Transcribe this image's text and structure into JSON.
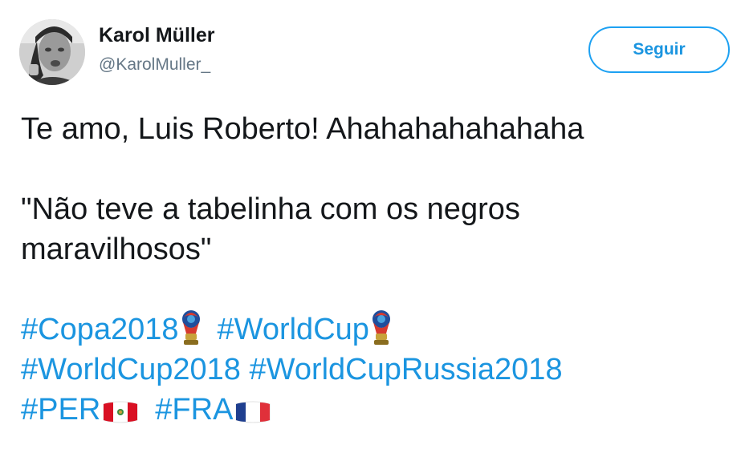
{
  "user": {
    "display_name": "Karol Müller",
    "handle": "@KarolMuller_"
  },
  "follow_button": {
    "label": "Seguir"
  },
  "tweet": {
    "line1": "Te amo, Luis Roberto! Ahahahahahahaha",
    "quote_line1": "\"Não teve a tabelinha com os negros",
    "quote_line2": "maravilhosos\"",
    "hashtags": {
      "copa2018": "#Copa2018",
      "worldcup": "#WorldCup",
      "worldcup2018": "#WorldCup2018",
      "worldcuprussia2018": "#WorldCupRussia2018",
      "per": "#PER",
      "fra": "#FRA"
    }
  },
  "icons": {
    "trophy": "world-cup-2018-emblem",
    "flag_peru": "peru-flag",
    "flag_france": "france-flag"
  },
  "colors": {
    "link": "#1b95e0",
    "button_border": "#1da1f2",
    "secondary_text": "#657786",
    "primary_text": "#14171a"
  }
}
